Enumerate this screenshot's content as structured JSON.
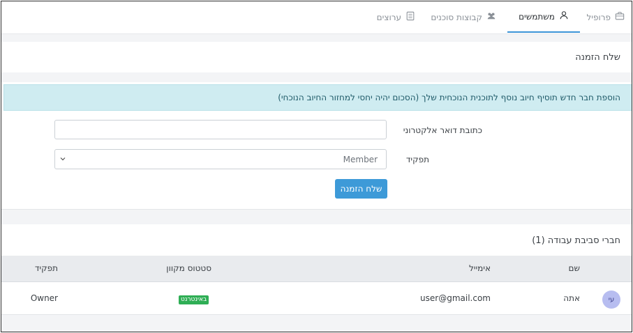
{
  "tabs": [
    {
      "label": "פרופיל",
      "icon": "briefcase-icon",
      "active": false
    },
    {
      "label": "משתמשים",
      "icon": "user-icon",
      "active": true
    },
    {
      "label": "קבוצות סוכנים",
      "icon": "users-icon",
      "active": false
    },
    {
      "label": "ערוצים",
      "icon": "channels-icon",
      "active": false
    }
  ],
  "invite": {
    "title": "שלח הזמנה",
    "alert": "הוספת חבר חדש תוסיף חיוב נוסף לתוכנית הנוכחית שלך (הסכום יהיה יחסי למחזור החיוב הנוכחי)",
    "email_label": "כתובת דואר אלקטרוני",
    "email_value": "",
    "role_label": "תפקיד",
    "role_value": "Member",
    "submit_label": "שלח הזמנה"
  },
  "members": {
    "title": "חברי סביבת עבודה (1)",
    "columns": {
      "name": "שם",
      "email": "אימייל",
      "online": "סטטוס מקוון",
      "role": "תפקיד"
    },
    "rows": [
      {
        "avatar": "עי",
        "name": "אתה",
        "email": "user@gmail.com",
        "online": "באינטרנט",
        "role": "Owner"
      }
    ]
  },
  "colors": {
    "accent": "#3d9ad8",
    "online": "#2fae55",
    "alert_bg": "#cfecf1",
    "avatar_bg": "#b7bdf0"
  }
}
